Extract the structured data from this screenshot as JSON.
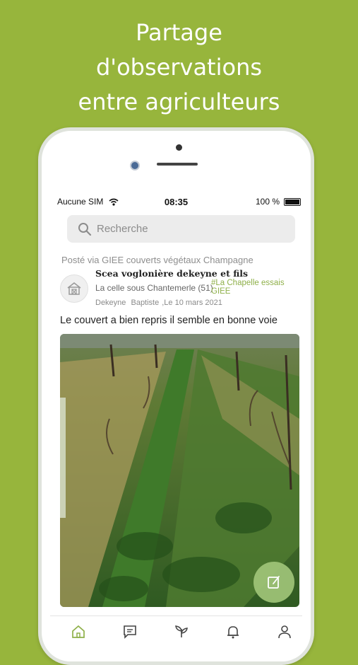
{
  "headline": {
    "line1": "Partage",
    "line2": "d'observations",
    "line3": "entre agriculteurs"
  },
  "status_bar": {
    "carrier": "Aucune SIM",
    "time": "08:35",
    "battery": "100 %"
  },
  "search": {
    "placeholder": "Recherche"
  },
  "post": {
    "posted_via": "Posté via GIEE couverts végétaux Champagne",
    "author": "Scea voglonière dekeyne et fils",
    "location": "La celle sous Chantemerle",
    "department": "(51)",
    "tag": "#La Chapelle essais GIEE",
    "last_name": "Dekeyne",
    "first_name": "Baptiste",
    "date": ",Le 10 mars 2021",
    "text": "Le couvert a bien repris il semble en bonne voie"
  },
  "tabs": [
    {
      "icon": "home-icon",
      "active": true
    },
    {
      "icon": "message-icon",
      "active": false
    },
    {
      "icon": "crop-icon",
      "active": false
    },
    {
      "icon": "bell-icon",
      "active": false
    },
    {
      "icon": "profile-icon",
      "active": false
    }
  ],
  "colors": {
    "background": "#97b53c",
    "accent": "#8fb04a",
    "fab": "#a0c478"
  }
}
